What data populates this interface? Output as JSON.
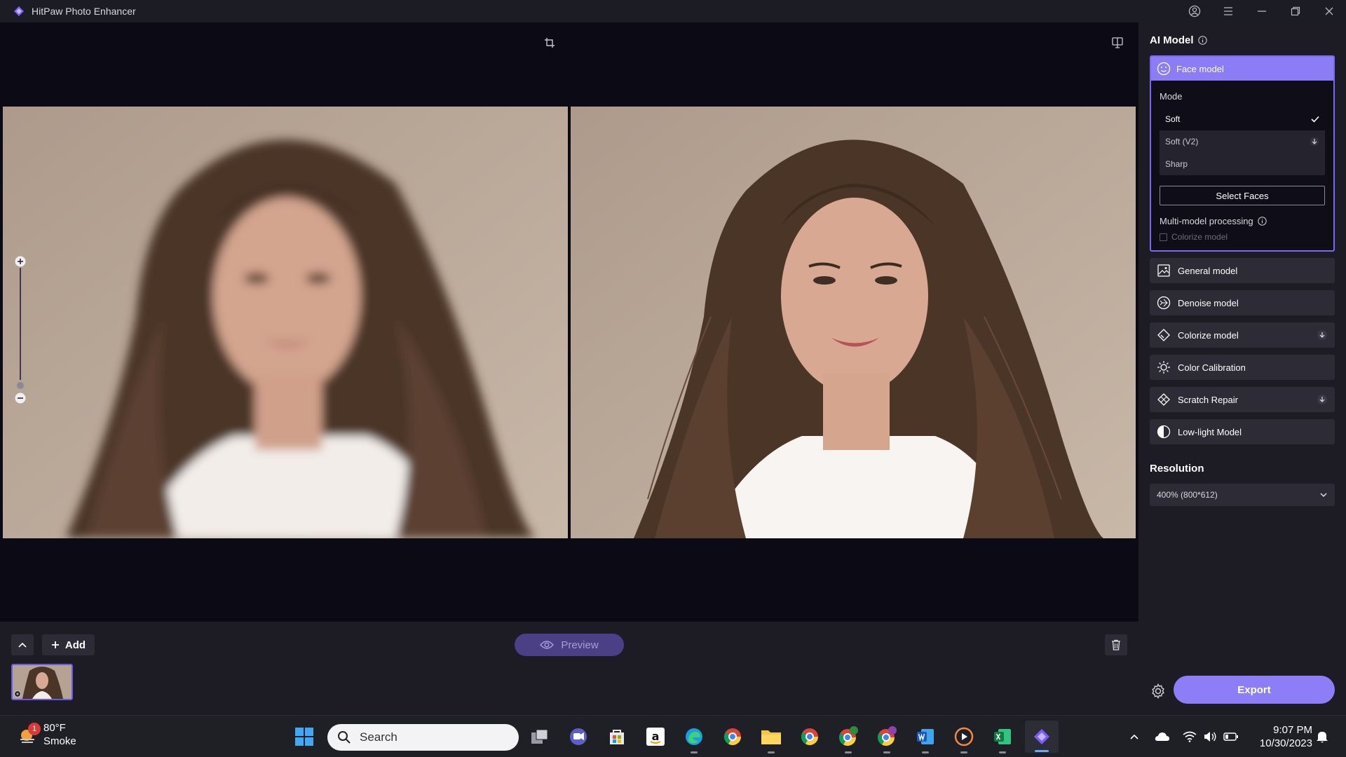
{
  "window": {
    "title": "HitPaw Photo Enhancer"
  },
  "panel": {
    "heading": "AI Model",
    "face_model": {
      "label": "Face model",
      "mode_label": "Mode",
      "modes": [
        {
          "label": "Soft",
          "selected": true
        },
        {
          "label": "Soft (V2)",
          "downloadable": true
        },
        {
          "label": "Sharp"
        }
      ],
      "select_faces_label": "Select Faces",
      "multi_model_label": "Multi-model processing",
      "colorize_checkbox_label": "Colorize model"
    },
    "models": [
      {
        "label": "General model",
        "icon": "image-icon"
      },
      {
        "label": "Denoise model",
        "icon": "denoise-icon"
      },
      {
        "label": "Colorize model",
        "icon": "colorize-icon",
        "downloadable": true
      },
      {
        "label": "Color Calibration",
        "icon": "sun-icon"
      },
      {
        "label": "Scratch Repair",
        "icon": "scratch-icon",
        "downloadable": true
      },
      {
        "label": "Low-light Model",
        "icon": "half-circle-icon"
      }
    ],
    "resolution_title": "Resolution",
    "resolution_value": "400% (800*612)",
    "export_label": "Export"
  },
  "strip": {
    "add_label": "Add",
    "preview_label": "Preview"
  },
  "taskbar": {
    "weather_temp": "80°F",
    "weather_desc": "Smoke",
    "weather_badge": "1",
    "search_placeholder": "Search",
    "time": "9:07 PM",
    "date": "10/30/2023"
  },
  "colors": {
    "accent": "#8d7df6",
    "panel_bg": "#1d1c25",
    "canvas_bg": "#0c0b15"
  }
}
